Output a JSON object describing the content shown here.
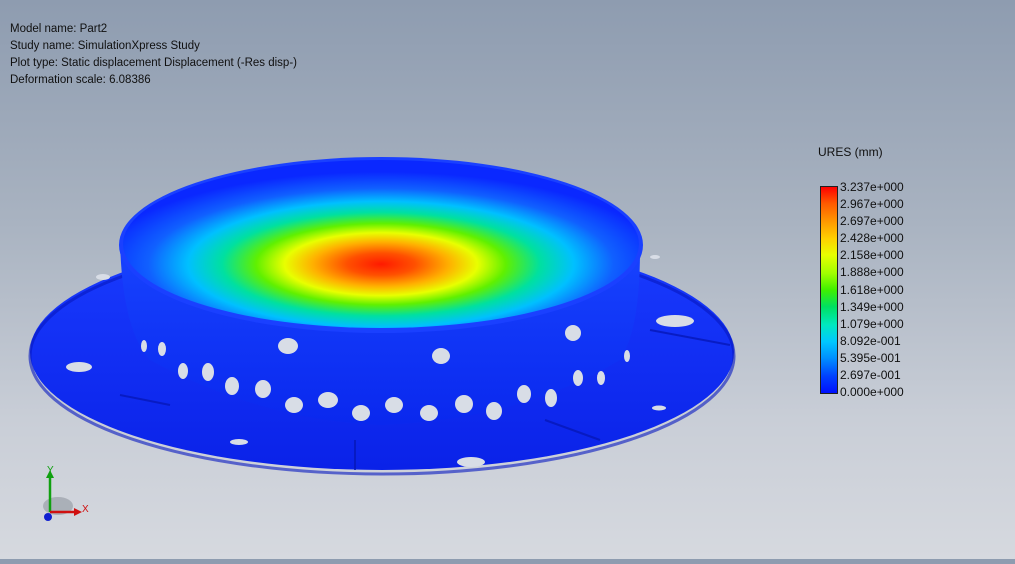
{
  "info": {
    "model": "Model name: Part2",
    "study": "Study name: SimulationXpress Study",
    "plot_type": "Plot type: Static displacement Displacement (-Res disp-)",
    "deformation": "Deformation scale: 6.08386"
  },
  "legend": {
    "title": "URES (mm)",
    "labels": [
      "3.237e+000",
      "2.967e+000",
      "2.697e+000",
      "2.428e+000",
      "2.158e+000",
      "1.888e+000",
      "1.618e+000",
      "1.349e+000",
      "1.079e+000",
      "8.092e-001",
      "5.395e-001",
      "2.697e-001",
      "0.000e+000"
    ]
  },
  "triad": {
    "x": "X",
    "y": "Y"
  },
  "colors": {
    "min": "#0a28ff",
    "max": "#ff1a00"
  }
}
